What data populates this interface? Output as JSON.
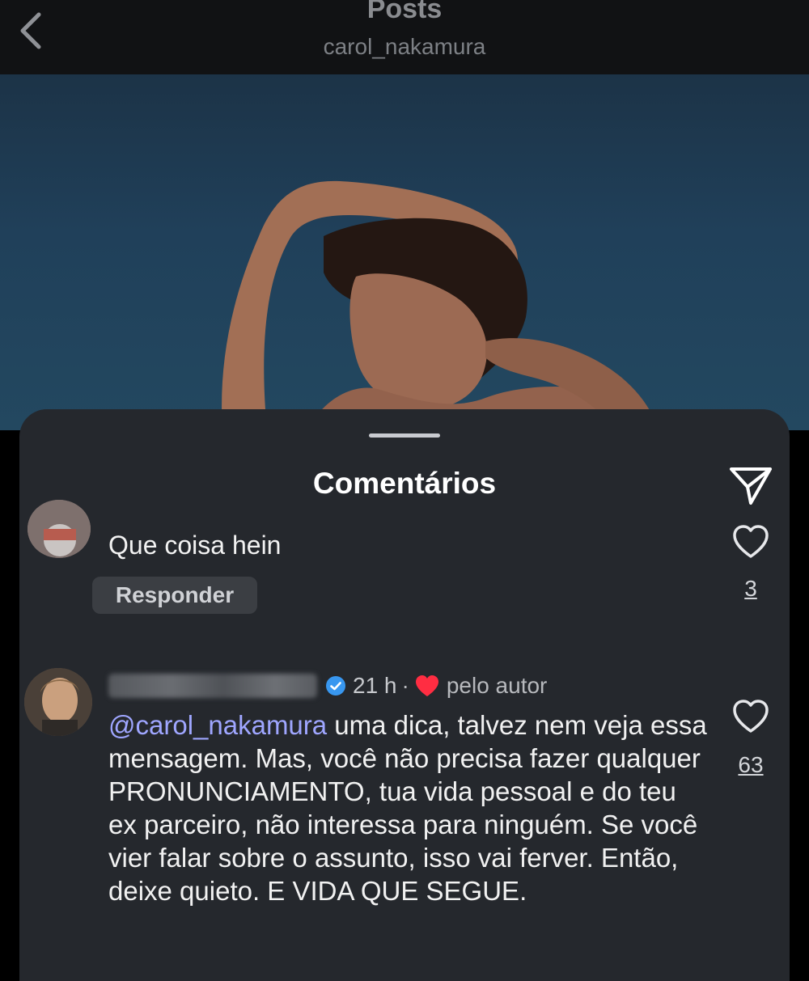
{
  "header": {
    "title": "Posts",
    "username": "carol_nakamura"
  },
  "sheet": {
    "title": "Comentários"
  },
  "comments": [
    {
      "text": "Que coisa hein",
      "reply_label": "Responder",
      "likes": "3"
    },
    {
      "time": "21 h",
      "separator": "·",
      "liked_by_author_label": "pelo autor",
      "mention": "@carol_nakamura",
      "text": " uma dica, talvez nem veja essa mensagem. Mas, você não precisa fazer qualquer PRONUNCIAMENTO, tua vida pessoal e do teu ex parceiro, não interessa para ninguém. Se você vier falar sobre o assunto, isso vai ferver. Então, deixe quieto. E VIDA QUE SEGUE.",
      "likes": "63"
    }
  ],
  "icons": {
    "back": "chevron-left-icon",
    "share": "paper-plane-icon",
    "like": "heart-outline-icon",
    "author_like": "heart-filled-icon",
    "verified": "verified-badge-icon"
  },
  "colors": {
    "sheet_bg": "#25282d",
    "mention": "#9fa6ff",
    "author_heart": "#ff2d42",
    "verified": "#3897f0"
  }
}
